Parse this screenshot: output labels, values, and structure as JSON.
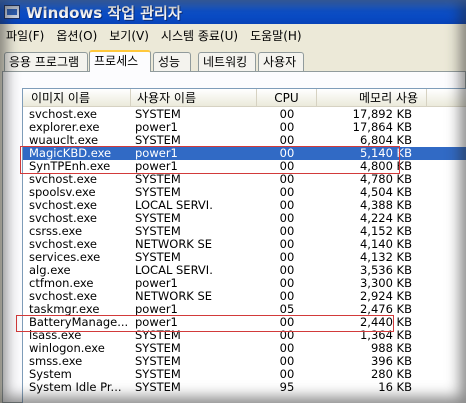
{
  "window": {
    "title": "Windows 작업 관리자"
  },
  "menu": [
    "파일(F)",
    "옵션(O)",
    "보기(V)",
    "시스템 종료(U)",
    "도움말(H)"
  ],
  "tabs": [
    "응용 프로그램",
    "프로세스",
    "성능",
    "네트워킹",
    "사용자"
  ],
  "active_tab": "프로세스",
  "columns": {
    "name": "이미지 이름",
    "user": "사용자 이름",
    "cpu": "CPU",
    "mem": "메모리 사용"
  },
  "processes": [
    {
      "name": "svchost.exe",
      "user": "SYSTEM",
      "cpu": "00",
      "mem": "17,892 KB"
    },
    {
      "name": "explorer.exe",
      "user": "power1",
      "cpu": "00",
      "mem": "17,864 KB"
    },
    {
      "name": "wuauclt.exe",
      "user": "SYSTEM",
      "cpu": "00",
      "mem": "6,804 KB"
    },
    {
      "name": "MagicKBD.exe",
      "user": "power1",
      "cpu": "00",
      "mem": "5,140 KB",
      "selected": true
    },
    {
      "name": "SynTPEnh.exe",
      "user": "power1",
      "cpu": "00",
      "mem": "4,800 KB"
    },
    {
      "name": "svchost.exe",
      "user": "SYSTEM",
      "cpu": "00",
      "mem": "4,780 KB"
    },
    {
      "name": "spoolsv.exe",
      "user": "SYSTEM",
      "cpu": "00",
      "mem": "4,504 KB"
    },
    {
      "name": "svchost.exe",
      "user": "LOCAL SERVI...",
      "cpu": "00",
      "mem": "4,388 KB"
    },
    {
      "name": "svchost.exe",
      "user": "SYSTEM",
      "cpu": "00",
      "mem": "4,224 KB"
    },
    {
      "name": "csrss.exe",
      "user": "SYSTEM",
      "cpu": "00",
      "mem": "4,152 KB"
    },
    {
      "name": "svchost.exe",
      "user": "NETWORK SE...",
      "cpu": "00",
      "mem": "4,140 KB"
    },
    {
      "name": "services.exe",
      "user": "SYSTEM",
      "cpu": "00",
      "mem": "4,132 KB"
    },
    {
      "name": "alg.exe",
      "user": "LOCAL SERVI...",
      "cpu": "00",
      "mem": "3,536 KB"
    },
    {
      "name": "ctfmon.exe",
      "user": "power1",
      "cpu": "00",
      "mem": "3,300 KB"
    },
    {
      "name": "svchost.exe",
      "user": "NETWORK SE...",
      "cpu": "00",
      "mem": "2,924 KB"
    },
    {
      "name": "taskmgr.exe",
      "user": "power1",
      "cpu": "05",
      "mem": "2,476 KB"
    },
    {
      "name": "BatteryManage...",
      "user": "power1",
      "cpu": "00",
      "mem": "2,440 KB"
    },
    {
      "name": "lsass.exe",
      "user": "SYSTEM",
      "cpu": "00",
      "mem": "1,364 KB"
    },
    {
      "name": "winlogon.exe",
      "user": "SYSTEM",
      "cpu": "00",
      "mem": "988 KB"
    },
    {
      "name": "smss.exe",
      "user": "SYSTEM",
      "cpu": "00",
      "mem": "396 KB"
    },
    {
      "name": "System",
      "user": "SYSTEM",
      "cpu": "00",
      "mem": "280 KB"
    },
    {
      "name": "System Idle Pr...",
      "user": "SYSTEM",
      "cpu": "95",
      "mem": "16 KB"
    }
  ],
  "colors": {
    "selection": "#316ac5",
    "highlight_box": "#d23a3a",
    "titlebar": "#0a53d6"
  }
}
